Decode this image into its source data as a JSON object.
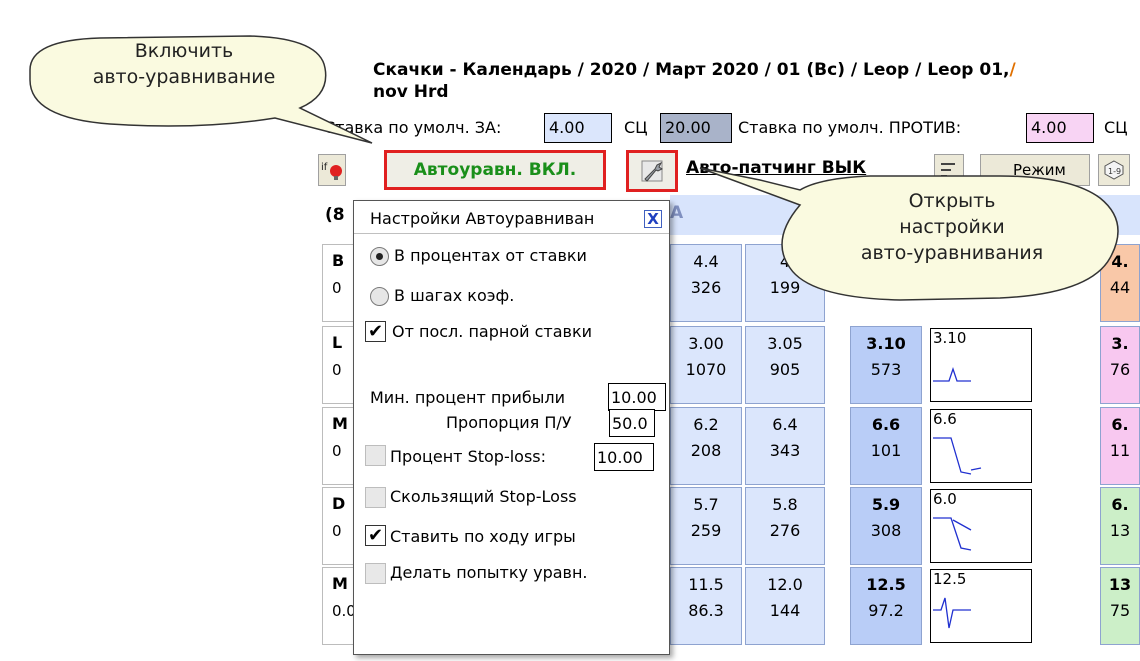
{
  "header": {
    "breadcrumb": "Скачки - Календарь / 2020 / Март 2020 / 01 (Вс) / Leop / Leop 01,",
    "breadcrumb_cut": "/",
    "subtitle": "nov Hrd"
  },
  "stakes": {
    "back_label": "Ставка по умолч. ЗА:",
    "back_value": "4.00",
    "sc1_label": "СЦ",
    "sc1_value": "20.00",
    "lay_label": "Ставка по умолч. ПРОТИВ:",
    "lay_value": "4.00",
    "sc2_label": "СЦ"
  },
  "toolbar": {
    "autobalance_label": "Автоуравн. ВКЛ.",
    "autopatching_label": "Авто-патчинг ВЫК",
    "mode_label": "Режим"
  },
  "grid": {
    "runners_count": "(8",
    "column_fragment": "A",
    "rows": [
      {
        "name": "B",
        "sub": "0",
        "c1t": "4.4",
        "c1b": "326",
        "c2t": "4",
        "c2b": "199",
        "c4t": "4.",
        "c4b": "44",
        "color": "#f9c8a8"
      },
      {
        "name": "L",
        "sub": "0",
        "c1t": "3.00",
        "c1b": "1070",
        "c2t": "3.05",
        "c2b": "905",
        "c3t": "3.10",
        "c3b": "573",
        "spark": "3.10",
        "c4t": "3.",
        "c4b": "76",
        "color": "#f8c8f0"
      },
      {
        "name": "M",
        "sub": "0",
        "c1t": "6.2",
        "c1b": "208",
        "c2t": "6.4",
        "c2b": "343",
        "c3t": "6.6",
        "c3b": "101",
        "spark": "6.6",
        "c4t": "6.",
        "c4b": "11",
        "color": "#f8c8f0"
      },
      {
        "name": "D",
        "sub": "0",
        "c1t": "5.7",
        "c1b": "259",
        "c2t": "5.8",
        "c2b": "276",
        "c3t": "5.9",
        "c3b": "308",
        "spark": "6.0",
        "c4t": "6.",
        "c4b": "13",
        "color": "#ccefc8"
      },
      {
        "name": "M",
        "sub": "0.00",
        "c1t": "11.5",
        "c1b": "86.3",
        "c2t": "12.0",
        "c2b": "144",
        "c3t": "12.5",
        "c3b": "97.2",
        "spark": "12.5",
        "c4t": "13",
        "c4b": "75",
        "color": "#ccefc8"
      }
    ]
  },
  "popup": {
    "title": "Настройки Автоуравниван",
    "close": "X",
    "radio_percent": "В процентах от ставки",
    "radio_ticks": "В шагах коэф.",
    "chk_last_pair": "От посл. парной ставки",
    "min_profit_label": "Мин. процент прибыли",
    "min_profit_value": "10.00",
    "ratio_label": "Пропорция П/У",
    "ratio_value": "50.0",
    "stoploss_label": "Процент Stop-loss:",
    "stoploss_value": "10.00",
    "trailing_label": "Скользящий Stop-Loss",
    "inplay_label": "Ставить по ходу игры",
    "try_label": "Делать попытку уравн."
  },
  "callouts": {
    "left_line1": "Включить",
    "left_line2": "авто-уравнивание",
    "right_line1": "Открыть",
    "right_line2": "настройки",
    "right_line3": "авто-уравнивания"
  },
  "icons": [
    "if-rule-icon",
    "wrench-settings-icon",
    "sort-icon",
    "odds-range-icon"
  ]
}
